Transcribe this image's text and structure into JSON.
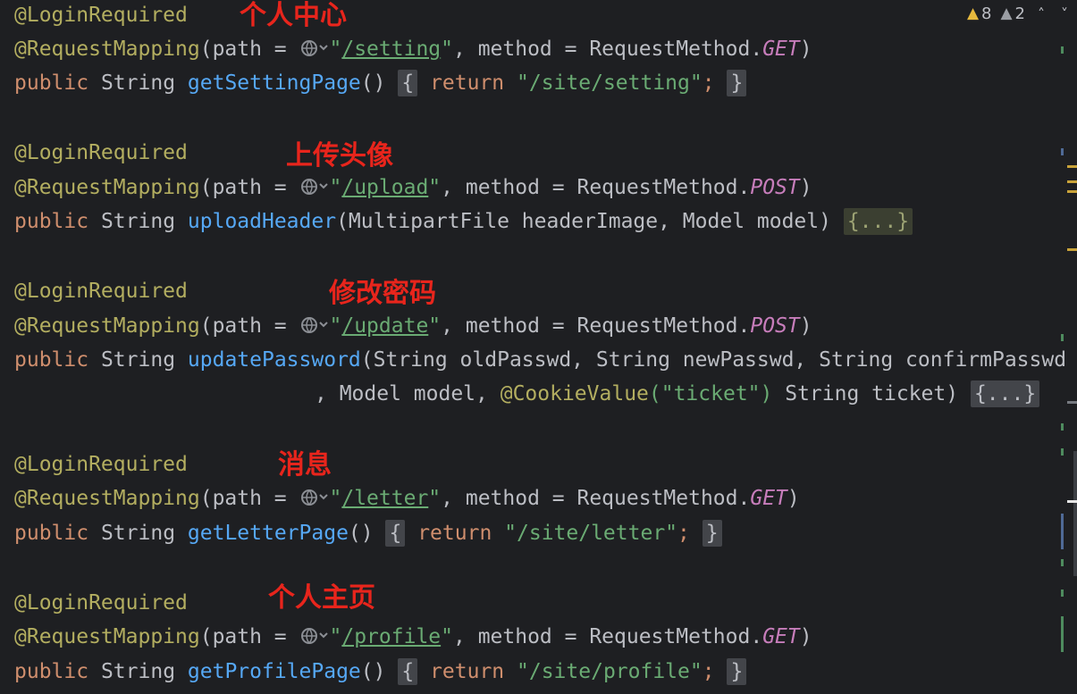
{
  "inspections": {
    "warnings": "8",
    "weak_warnings": "2",
    "up_icon": "chevron-up-icon",
    "down_icon": "chevron-down-icon"
  },
  "labels": [
    "个人中心",
    "上传头像",
    "修改密码",
    "消息",
    "个人主页"
  ],
  "code": {
    "login_required": "@LoginRequired",
    "request_mapping": "@RequestMapping",
    "path_open": "(path = ",
    "method_part": ", method = RequestMethod.",
    "close_paren": ")",
    "public": "public",
    "string": "String",
    "return": "return",
    "ellipsis": "{...}",
    "cookie_ann": "@CookieValue",
    "blocks": [
      {
        "path": "/setting",
        "method": "GET",
        "fn": "getSettingPage",
        "params": "()",
        "ret": "\"/site/setting\""
      },
      {
        "path": "/upload",
        "method": "POST",
        "fn": "uploadHeader",
        "params": "(MultipartFile headerImage, Model model)"
      },
      {
        "path": "/update",
        "method": "POST",
        "fn": "updatePassword",
        "params": "(String oldPasswd, String newPasswd, String confirmPasswd",
        "params2": ", Model model, ",
        "cookie_arg": "(\"ticket\")",
        "params3": " String ticket)"
      },
      {
        "path": "/letter",
        "method": "GET",
        "fn": "getLetterPage",
        "params": "()",
        "ret": "\"/site/letter\""
      },
      {
        "path": "/profile",
        "method": "GET",
        "fn": "getProfilePage",
        "params": "()",
        "ret": "\"/site/profile\""
      }
    ]
  }
}
